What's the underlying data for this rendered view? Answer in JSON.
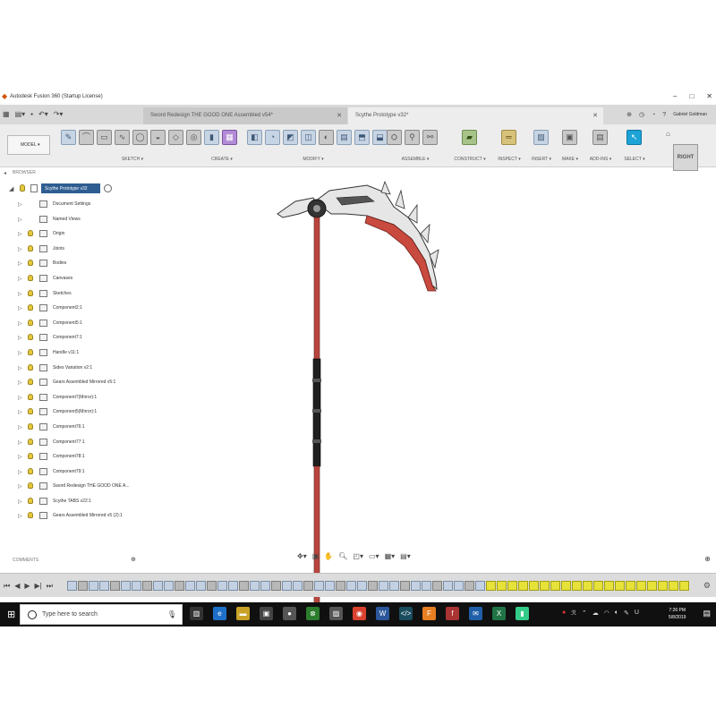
{
  "window": {
    "title": "Autodesk Fusion 360 (Startup License)",
    "icons": {
      "app": "fusion-icon",
      "minimize": "minimize-icon",
      "maximize": "maximize-icon",
      "close": "close-icon"
    }
  },
  "tabs": [
    {
      "label": "Sword Redesign THE GOOD ONE Assembled v54*",
      "active": false
    },
    {
      "label": "Scythe Prototype v32*",
      "active": true
    }
  ],
  "user": {
    "name": "Gabriel Goldman"
  },
  "toolbar": {
    "workspace_label": "MODEL ▾",
    "groups": [
      {
        "label": "SKETCH ▾"
      },
      {
        "label": "CREATE ▾"
      },
      {
        "label": "MODIFY ▾"
      },
      {
        "label": "ASSEMBLE ▾"
      },
      {
        "label": "CONSTRUCT ▾"
      },
      {
        "label": "INSPECT ▾"
      },
      {
        "label": "INSERT ▾"
      },
      {
        "label": "MAKE ▾"
      },
      {
        "label": "ADD-INS ▾"
      },
      {
        "label": "SELECT ▾"
      }
    ]
  },
  "viewcube": {
    "face": "RIGHT"
  },
  "browser": {
    "header": "BROWSER",
    "root": "Scythe Prototype v32",
    "items": [
      {
        "label": "Document Settings",
        "icon": "gear-icon",
        "bulb": false
      },
      {
        "label": "Named Views",
        "icon": "folder-icon",
        "bulb": false
      },
      {
        "label": "Origin",
        "icon": "folder-icon",
        "bulb": true
      },
      {
        "label": "Joints",
        "icon": "folder-icon",
        "bulb": true
      },
      {
        "label": "Bodies",
        "icon": "folder-icon",
        "bulb": true
      },
      {
        "label": "Canvases",
        "icon": "folder-icon",
        "bulb": true
      },
      {
        "label": "Sketches",
        "icon": "folder-icon",
        "bulb": true
      },
      {
        "label": "Component2:1",
        "icon": "component-icon",
        "bulb": true
      },
      {
        "label": "Component5:1",
        "icon": "component-icon",
        "bulb": true
      },
      {
        "label": "Component7:1",
        "icon": "component-icon",
        "bulb": true
      },
      {
        "label": "Handle v11:1",
        "icon": "component-icon",
        "bulb": true
      },
      {
        "label": "Sides Variation v2:1",
        "icon": "component-icon",
        "bulb": true
      },
      {
        "label": "Gears Assembled Mirrored v5:1",
        "icon": "component-icon",
        "bulb": true
      },
      {
        "label": "Component7(Mirror):1",
        "icon": "component-icon",
        "bulb": true
      },
      {
        "label": "Component5(Mirror):1",
        "icon": "component-icon",
        "bulb": true
      },
      {
        "label": "Component76:1",
        "icon": "component-icon",
        "bulb": true
      },
      {
        "label": "Component77:1",
        "icon": "component-icon",
        "bulb": true
      },
      {
        "label": "Component78:1",
        "icon": "component-icon",
        "bulb": true
      },
      {
        "label": "Component79:1",
        "icon": "component-icon",
        "bulb": true
      },
      {
        "label": "Sword Redesign THE GOOD ONE A...",
        "icon": "component-icon",
        "bulb": true
      },
      {
        "label": "Scythe TABS v22:1",
        "icon": "component-icon",
        "bulb": true
      },
      {
        "label": "Gears Assembled Mirrored v5 (2):1",
        "icon": "component-icon",
        "bulb": true
      }
    ]
  },
  "comments": {
    "header": "COMMENTS"
  },
  "taskbar": {
    "search_placeholder": "Type here to search",
    "time": "7:26 PM",
    "date": "5/8/2019"
  },
  "colors": {
    "accent": "#2e5d91",
    "handle": "#b8463f",
    "blade": "#e4e4e4",
    "timeline_highlight": "#e7e23a"
  }
}
